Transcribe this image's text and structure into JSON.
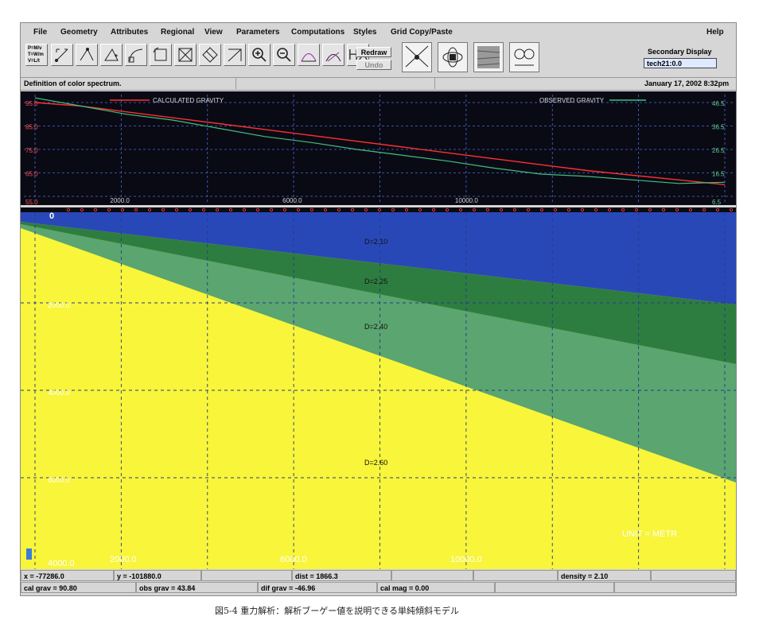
{
  "menu": {
    "items": [
      "File",
      "Geometry",
      "Attributes",
      "Regional",
      "View",
      "Parameters",
      "Computations",
      "Styles",
      "Grid Copy/Paste"
    ],
    "help": "Help"
  },
  "toolbar": {
    "formula": [
      "P=M/v",
      "T=W/m",
      "V=L/t"
    ],
    "redraw_label": "Redraw",
    "undo_label": "Undo",
    "hx_label": "HX",
    "secondary_display_label": "Secondary Display",
    "secondary_display_value": "tech21:0.0",
    "icons": [
      "select-tool-icon",
      "move-point-icon",
      "add-point-icon",
      "curve-tool-icon",
      "polygon-rotate-icon",
      "zoom-box-icon",
      "shrink-box-icon",
      "delete-point-icon",
      "zoom-in-icon",
      "zoom-out-icon",
      "curve-fit-icon",
      "curve-edit-icon"
    ]
  },
  "status": {
    "message": "Definition of color spectrum.",
    "datetime": "January 17, 2002 8:32pm"
  },
  "gravity_plot": {
    "legend_calculated": "CALCULATED GRAVITY",
    "legend_observed": "OBSERVED GRAVITY",
    "left_ticks": [
      "95.0",
      "85.0",
      "75.0",
      "65.0",
      "55.0"
    ],
    "right_ticks": [
      "46.5",
      "36.5",
      "26.5",
      "16.5",
      "6.5"
    ],
    "x_ticks": [
      "2000.0",
      "6000.0",
      "10000.0"
    ],
    "colors": {
      "background": "#0a0a14",
      "calculated": "#ff3030",
      "observed": "#40c080",
      "grid": "#4a6bd8"
    },
    "calculated_values": [
      95.0,
      93.5,
      91.0,
      88.5,
      86.0,
      83.5,
      81.0,
      78.5,
      76.0,
      73.5,
      71.0,
      68.5,
      66.0,
      64.0,
      62.0,
      60.0
    ],
    "observed_values": [
      48.5,
      45.0,
      41.5,
      39.0,
      35.5,
      32.0,
      29.5,
      26.5,
      24.0,
      21.5,
      18.5,
      16.0,
      15.0,
      13.5,
      12.0,
      12.5
    ]
  },
  "model": {
    "origin_label": "0",
    "layers": [
      {
        "label": "D=2.10",
        "color": "#2948b8"
      },
      {
        "label": "D=2.25",
        "color": "#2e7d40"
      },
      {
        "label": "D=2.40",
        "color": "#5aa570"
      },
      {
        "label": "D=2.60",
        "color": "#f8f53a"
      }
    ],
    "depth_ticks": [
      "2000.0",
      "4000.0",
      "6000.0"
    ],
    "x_ticks": [
      "4000.0",
      "2000.0",
      "6000.0",
      "10000.0"
    ],
    "units": "UNIT = METR"
  },
  "readouts": {
    "row1": [
      "x = -77286.0",
      "y = -101880.0",
      "",
      "dist = 1866.3",
      "",
      "",
      "density = 2.10",
      ""
    ],
    "row2": [
      "cal grav = 90.80",
      "obs grav = 43.84",
      "dif grav = -46.96",
      "cal mag = 0.00",
      "",
      ""
    ]
  },
  "caption": "図5-4 重力解析：解析ブーゲー値を説明できる単純傾斜モデル"
}
